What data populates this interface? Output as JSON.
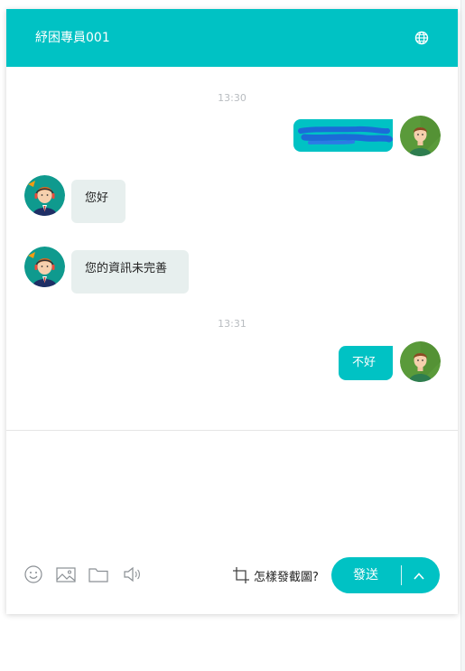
{
  "header": {
    "title": "紓困專員001",
    "globe_icon": "globe-icon"
  },
  "messages": [
    {
      "type": "time",
      "text": "13:30"
    },
    {
      "type": "out",
      "text": "",
      "redacted": true
    },
    {
      "type": "in",
      "text": "您好"
    },
    {
      "type": "in",
      "text": "您的資訊未完善"
    },
    {
      "type": "time",
      "text": "13:31"
    },
    {
      "type": "out",
      "text": "不好"
    }
  ],
  "toolbar": {
    "icons": [
      "emoji-icon",
      "image-icon",
      "folder-icon",
      "speaker-icon"
    ],
    "screenshot_label": "怎樣發截圖?",
    "screenshot_icon": "crop-icon"
  },
  "send": {
    "label": "發送",
    "expand_icon": "chevron-up-icon"
  },
  "colors": {
    "accent": "#00c2c4",
    "incoming_bubble": "#e7efee",
    "redaction": "#1b6bd8"
  }
}
